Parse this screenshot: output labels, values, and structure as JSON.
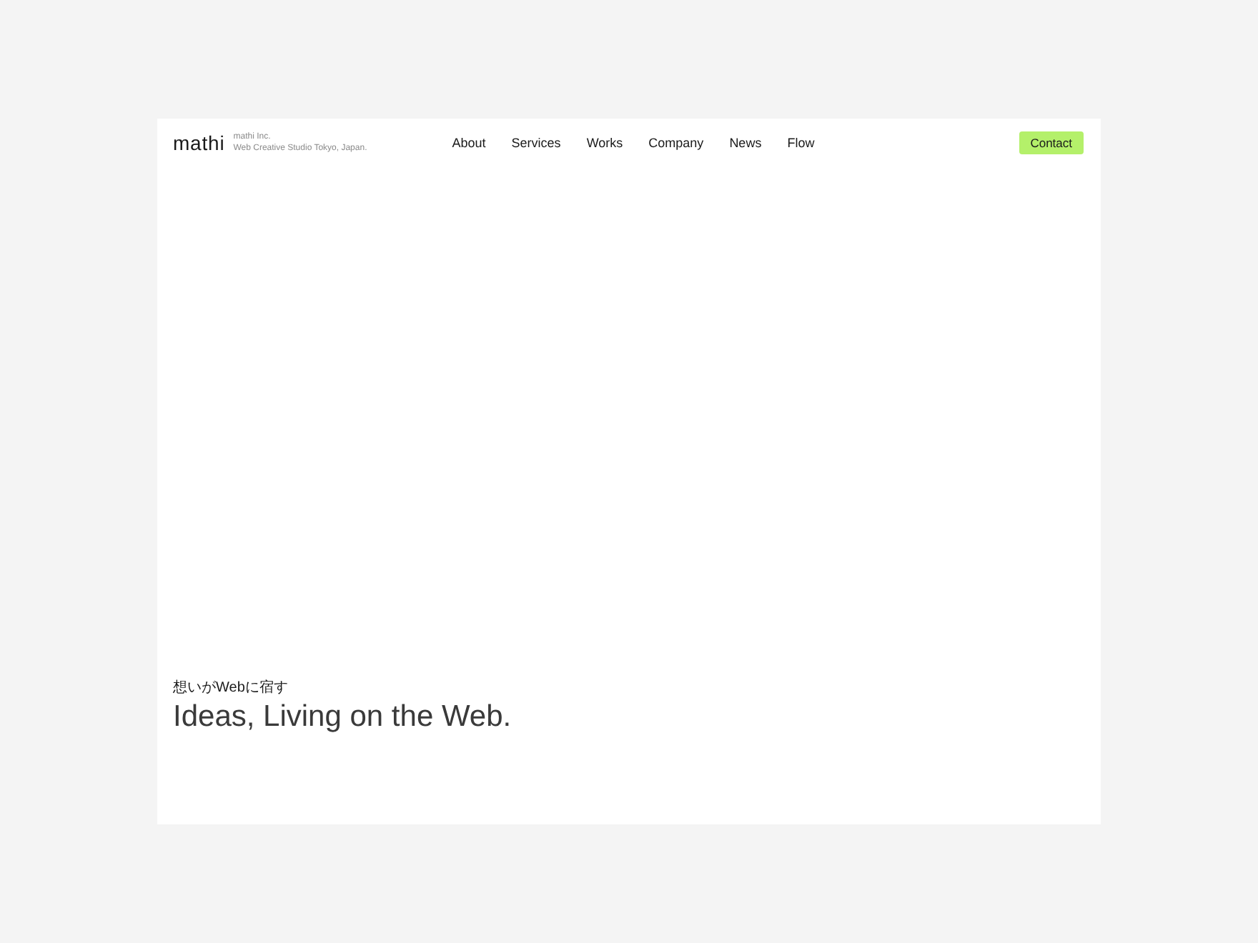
{
  "logo": {
    "wordmark": "mathi",
    "tagline": [
      "mathi Inc.",
      "Web Creative Studio Tokyo, Japan."
    ]
  },
  "nav": {
    "items": [
      {
        "label": "About"
      },
      {
        "label": "Services"
      },
      {
        "label": "Works"
      },
      {
        "label": "Company"
      },
      {
        "label": "News"
      },
      {
        "label": "Flow"
      }
    ],
    "contact": "Contact"
  },
  "hero": {
    "subtitle": "想いがWebに宿す",
    "title": "Ideas, Living on the Web."
  }
}
